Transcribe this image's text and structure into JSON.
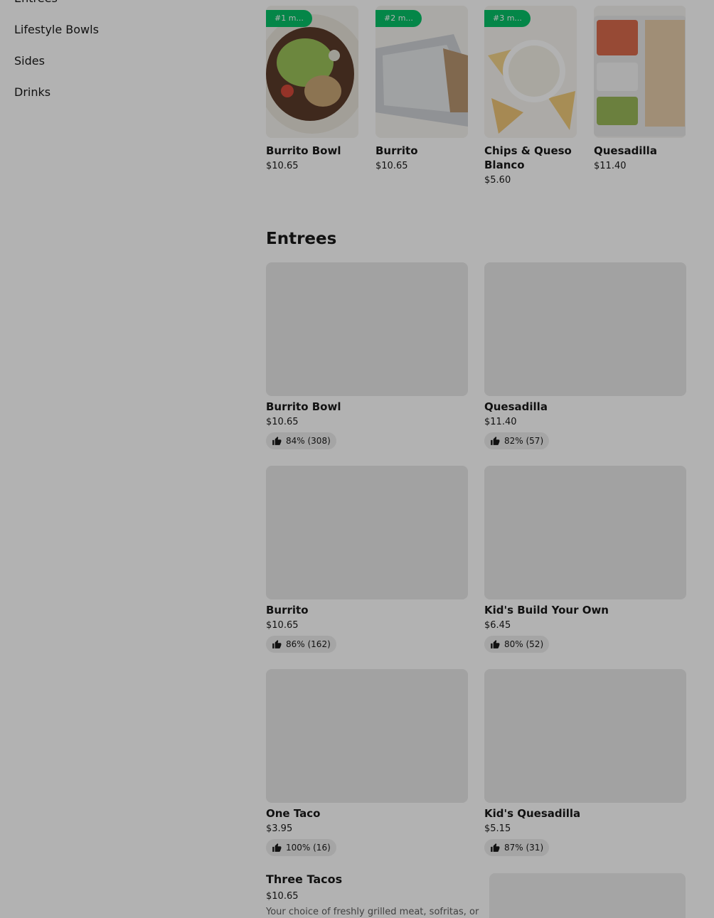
{
  "sidebar": {
    "items": [
      {
        "label": "Entrees"
      },
      {
        "label": "Lifestyle Bowls"
      },
      {
        "label": "Sides"
      },
      {
        "label": "Drinks"
      }
    ]
  },
  "popular": {
    "items": [
      {
        "badge": "#1 m...",
        "title": "Burrito Bowl",
        "price": "$10.65"
      },
      {
        "badge": "#2 m...",
        "title": "Burrito",
        "price": "$10.65"
      },
      {
        "badge": "#3 m...",
        "title": "Chips & Queso Blanco",
        "price": "$5.60"
      },
      {
        "badge": "",
        "title": "Quesadilla",
        "price": "$11.40"
      }
    ]
  },
  "entrees": {
    "title": "Entrees",
    "items": [
      {
        "title": "Burrito Bowl",
        "price": "$10.65",
        "rating": "84% (308)"
      },
      {
        "title": "Quesadilla",
        "price": "$11.40",
        "rating": "82% (57)"
      },
      {
        "title": "Burrito",
        "price": "$10.65",
        "rating": "86% (162)"
      },
      {
        "title": "Kid's Build Your Own",
        "price": "$6.45",
        "rating": "80% (52)"
      },
      {
        "title": "One Taco",
        "price": "$3.95",
        "rating": "100% (16)"
      },
      {
        "title": "Kid's Quesadilla",
        "price": "$5.15",
        "rating": "87% (31)"
      }
    ],
    "list_item": {
      "title": "Three Tacos",
      "price": "$10.65",
      "description": "Your choice of freshly grilled meat, sofritas, or"
    }
  },
  "colors": {
    "badge": "#06c167",
    "overlay": "rgba(0,0,0,0.30)"
  }
}
